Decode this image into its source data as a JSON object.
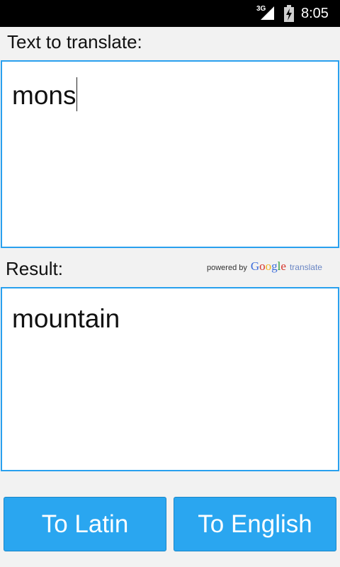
{
  "status_bar": {
    "network": "3G",
    "time": "8:05"
  },
  "input": {
    "label": "Text to translate:",
    "value": "mons"
  },
  "result": {
    "label": "Result:",
    "value": "mountain"
  },
  "attribution": {
    "powered_by": "powered by",
    "brand": "Google",
    "product": "translate"
  },
  "buttons": {
    "to_latin": "To Latin",
    "to_english": "To English"
  },
  "colors": {
    "accent": "#29a0ee",
    "button": "#2aa6f0"
  }
}
